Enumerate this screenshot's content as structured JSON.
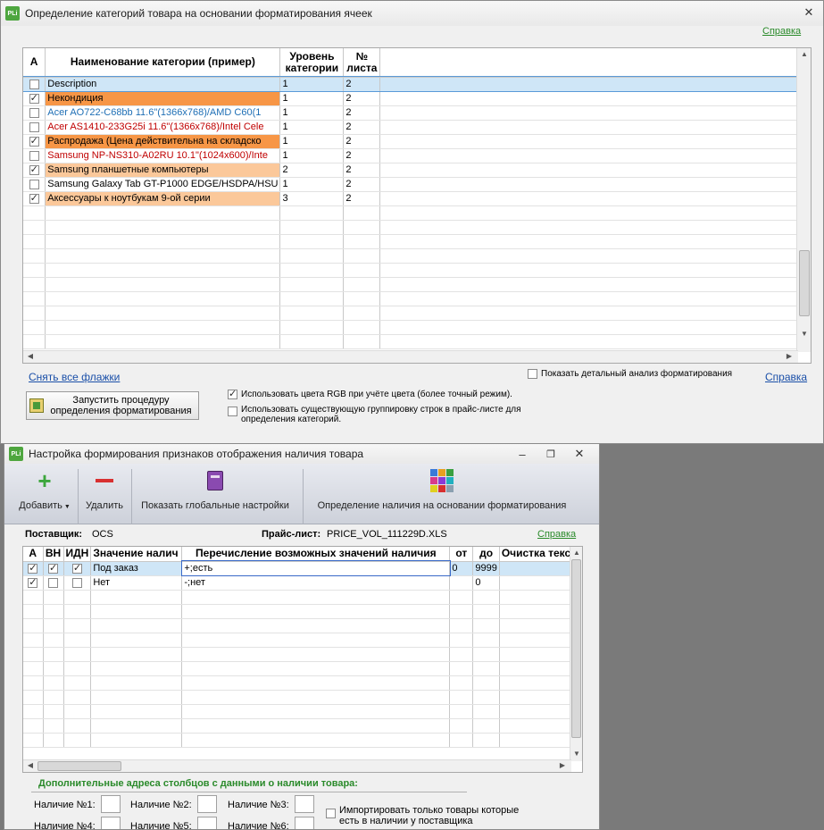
{
  "win1": {
    "title": "Определение категорий товара на основании форматирования ячеек",
    "help_top": "Справка",
    "help_bottom": "Справка",
    "columns": {
      "a": "A",
      "name": "Наименование категории (пример)",
      "level": "Уровень категории",
      "sheet": "№ листа"
    },
    "rows": [
      {
        "checked": false,
        "name": "Description",
        "level": "1",
        "sheet": "2",
        "bg": "#cfe6f7",
        "color": "#000000"
      },
      {
        "checked": true,
        "name": "Некондиция",
        "level": "1",
        "sheet": "2",
        "bg": "#f79646",
        "color": "#000000"
      },
      {
        "checked": false,
        "name": "Acer AO722-C68bb 11.6\"(1366x768)/AMD  C60(1",
        "level": "1",
        "sheet": "2",
        "bg": "#ffffff",
        "color": "#1f6fb5"
      },
      {
        "checked": false,
        "name": "Acer AS1410-233G25i 11.6\"(1366x768)/Intel Cele",
        "level": "1",
        "sheet": "2",
        "bg": "#ffffff",
        "color": "#c00000"
      },
      {
        "checked": true,
        "name": "Распродажа (Цена действительна на складско",
        "level": "1",
        "sheet": "2",
        "bg": "#f79646",
        "color": "#000000"
      },
      {
        "checked": false,
        "name": "Samsung NP-NS310-A02RU 10.1\"(1024x600)/Inte",
        "level": "1",
        "sheet": "2",
        "bg": "#ffffff",
        "color": "#c00000"
      },
      {
        "checked": true,
        "name": "Samsung планшетные компьютеры",
        "level": "2",
        "sheet": "2",
        "bg": "#fbc89a",
        "color": "#000000"
      },
      {
        "checked": false,
        "name": "Samsung Galaxy Tab GT-P1000  EDGE/HSDPA/HSU",
        "level": "1",
        "sheet": "2",
        "bg": "#ffffff",
        "color": "#000000"
      },
      {
        "checked": true,
        "name": "Аксессуары к ноутбукам 9-ой серии",
        "level": "3",
        "sheet": "2",
        "bg": "#fbc89a",
        "color": "#000000"
      }
    ],
    "uncheck_all": "Снять все флажки",
    "detail_analysis": "Показать детальный анализ форматирования",
    "run_button": "Запустить процедуру определения форматирования",
    "use_rgb": "Использовать цвета RGB при учёте цвета (более точный режим).",
    "use_grouping": "Использовать существующую группировку строк в прайс-листе для определения категорий."
  },
  "win2": {
    "title": "Настройка формирования признаков отображения наличия товара",
    "toolbar": {
      "add": "Добавить",
      "delete": "Удалить",
      "global": "Показать глобальные настройки",
      "detect": "Определение наличия на основании форматирования"
    },
    "supplier_label": "Поставщик:",
    "supplier_value": "OCS",
    "pricelist_label": "Прайс-лист:",
    "pricelist_value": "PRICE_VOL_111229D.XLS",
    "help": "Справка",
    "columns": {
      "a": "А",
      "vn": "ВН",
      "idn": "ИДН",
      "value": "Значение налич",
      "enum": "Перечисление возможных значений наличия",
      "from": "от",
      "to": "до",
      "clean": "Очистка текс"
    },
    "rows": [
      {
        "a": true,
        "vn": true,
        "idn": true,
        "value": "Под заказ",
        "enum": "+;есть",
        "from": "0",
        "to": "9999"
      },
      {
        "a": true,
        "vn": false,
        "idn": false,
        "value": "Нет",
        "enum": "-;нет",
        "from": "",
        "to": "0"
      }
    ],
    "extra_title": "Дополнительные адреса столбцов с данными о наличии товара:",
    "avail_labels": [
      "Наличие №1:",
      "Наличие №2:",
      "Наличие №3:",
      "Наличие №4:",
      "Наличие №5:",
      "Наличие №6:"
    ],
    "import_only": "Импортировать только товары которые есть в наличии у поставщика"
  }
}
